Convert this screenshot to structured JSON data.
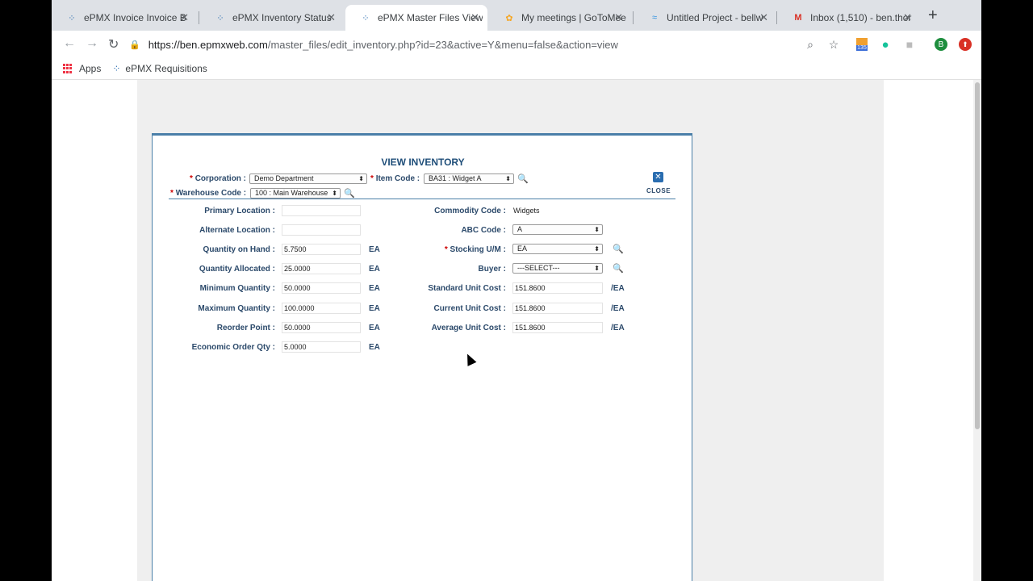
{
  "tabs": [
    {
      "title": "ePMX Invoice Invoice B",
      "icon": "epmx-icon"
    },
    {
      "title": "ePMX Inventory Status",
      "icon": "epmx-icon"
    },
    {
      "title": "ePMX Master Files View",
      "icon": "epmx-icon"
    },
    {
      "title": "My meetings | GoToMee",
      "icon": "gotomeeting-icon"
    },
    {
      "title": "Untitled Project - bellw",
      "icon": "project-icon"
    },
    {
      "title": "Inbox (1,510) - ben.thor",
      "icon": "gmail-icon"
    }
  ],
  "url": {
    "host": "https://ben.epmxweb.com",
    "path": "/master_files/edit_inventory.php?id=23&active=Y&menu=false&action=view"
  },
  "bookmarks": {
    "apps": "Apps",
    "requisitions": "ePMX Requisitions"
  },
  "profile_initial": "B",
  "extension_badge": "135",
  "form": {
    "title": "VIEW INVENTORY",
    "close_label": "CLOSE",
    "corporation_label": "Corporation :",
    "corporation_value": "Demo Department",
    "item_code_label": "Item Code :",
    "item_code_value": "BA31 : Widget A",
    "warehouse_label": "Warehouse Code :",
    "warehouse_value": "100 : Main Warehouse",
    "left_fields": [
      {
        "label": "Primary Location :",
        "value": "",
        "unit": ""
      },
      {
        "label": "Alternate Location :",
        "value": "",
        "unit": ""
      },
      {
        "label": "Quantity on Hand :",
        "value": "5.7500",
        "unit": "EA"
      },
      {
        "label": "Quantity Allocated :",
        "value": "25.0000",
        "unit": "EA"
      },
      {
        "label": "Minimum Quantity :",
        "value": "50.0000",
        "unit": "EA"
      },
      {
        "label": "Maximum Quantity :",
        "value": "100.0000",
        "unit": "EA"
      },
      {
        "label": "Reorder Point :",
        "value": "50.0000",
        "unit": "EA"
      },
      {
        "label": "Economic Order Qty :",
        "value": "5.0000",
        "unit": "EA"
      }
    ],
    "commodity_label": "Commodity Code :",
    "commodity_value": "Widgets",
    "abc_label": "ABC Code :",
    "abc_value": "A",
    "stocking_label": "Stocking U/M :",
    "stocking_value": "EA",
    "buyer_label": "Buyer :",
    "buyer_value": "---SELECT---",
    "cost_fields": [
      {
        "label": "Standard Unit Cost :",
        "value": "151.8600",
        "unit": "/EA"
      },
      {
        "label": "Current Unit Cost :",
        "value": "151.8600",
        "unit": "/EA"
      },
      {
        "label": "Average Unit Cost :",
        "value": "151.8600",
        "unit": "/EA"
      }
    ]
  }
}
